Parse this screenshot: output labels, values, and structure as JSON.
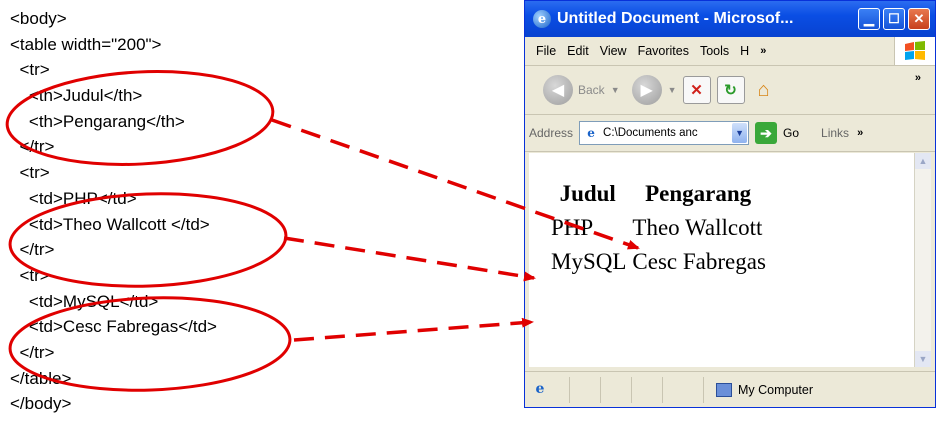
{
  "code_lines": [
    "<body>",
    "<table width=\"200\">",
    "  <tr>",
    "    <th>Judul</th>",
    "    <th>Pengarang</th>",
    "  </tr>",
    "  <tr>",
    "    <td>PHP</td>",
    "    <td>Theo Wallcott </td>",
    "  </tr>",
    "  <tr>",
    "    <td>MySQL</td>",
    "    <td>Cesc Fabregas</td>",
    "  </tr>",
    "</table>",
    "</body>"
  ],
  "window": {
    "title": "Untitled Document - Microsof...",
    "menu": [
      "File",
      "Edit",
      "View",
      "Favorites",
      "Tools",
      "H"
    ],
    "menu_more": "»",
    "toolbar_back": "Back",
    "toolbar_more": "»",
    "address_label": "Address",
    "address_value": "C:\\Documents anc",
    "go_label": "Go",
    "links_label": "Links",
    "links_more": "»",
    "status_zone": "My Computer"
  },
  "rendered_table": {
    "headers": [
      "Judul",
      "Pengarang"
    ],
    "rows": [
      [
        "PHP",
        "Theo Wallcott"
      ],
      [
        "MySQL",
        "Cesc Fabregas"
      ]
    ]
  },
  "annotation_color": "#e00000",
  "icons": [
    "ie-icon",
    "minimize-icon",
    "maximize-icon",
    "close-icon",
    "windows-flag-icon",
    "back-icon",
    "forward-icon",
    "stop-icon",
    "refresh-icon",
    "home-icon",
    "go-icon",
    "my-computer-icon"
  ]
}
